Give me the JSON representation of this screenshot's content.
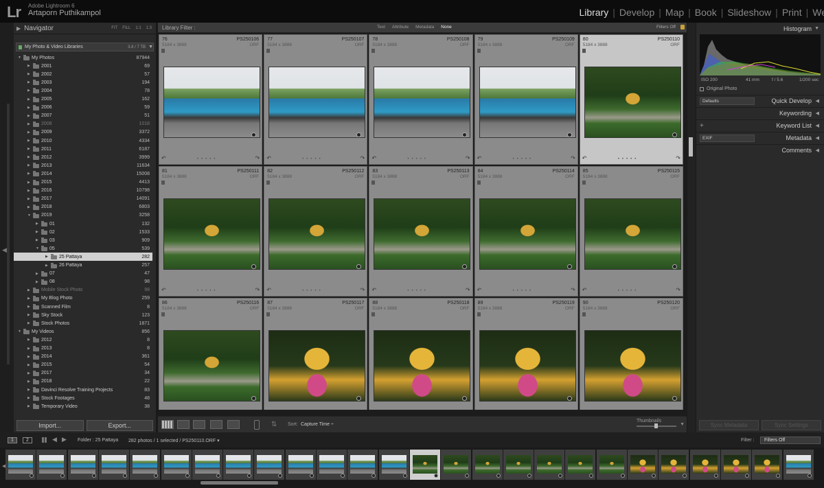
{
  "app": {
    "logo": "Lr",
    "name": "Adobe Lightroom 6",
    "user": "Artaporn Puthikampol"
  },
  "modules": [
    "Library",
    "Develop",
    "Map",
    "Book",
    "Slideshow",
    "Print",
    "We"
  ],
  "active_module": "Library",
  "left_panel": {
    "navigator": {
      "title": "Navigator",
      "zoom_options": [
        "FIT",
        "FILL",
        "1:1",
        "1:3"
      ]
    },
    "library": {
      "name": "My Photo & Video  Libraries",
      "size": "3.8 / 7 TB"
    },
    "folders": [
      {
        "name": "My Photos",
        "count": "87944",
        "level": 0,
        "expanded": true
      },
      {
        "name": "2001",
        "count": "69",
        "level": 1
      },
      {
        "name": "2002",
        "count": "57",
        "level": 1
      },
      {
        "name": "2003",
        "count": "194",
        "level": 1
      },
      {
        "name": "2004",
        "count": "78",
        "level": 1
      },
      {
        "name": "2005",
        "count": "162",
        "level": 1
      },
      {
        "name": "2006",
        "count": "59",
        "level": 1
      },
      {
        "name": "2007",
        "count": "51",
        "level": 1
      },
      {
        "name": "2008",
        "count": "1018",
        "level": 1,
        "dim": true
      },
      {
        "name": "2009",
        "count": "3372",
        "level": 1
      },
      {
        "name": "2010",
        "count": "4334",
        "level": 1
      },
      {
        "name": "2011",
        "count": "6187",
        "level": 1
      },
      {
        "name": "2012",
        "count": "3999",
        "level": 1
      },
      {
        "name": "2013",
        "count": "11634",
        "level": 1
      },
      {
        "name": "2014",
        "count": "15008",
        "level": 1
      },
      {
        "name": "2015",
        "count": "4413",
        "level": 1
      },
      {
        "name": "2016",
        "count": "10798",
        "level": 1
      },
      {
        "name": "2017",
        "count": "14091",
        "level": 1
      },
      {
        "name": "2018",
        "count": "6803",
        "level": 1
      },
      {
        "name": "2019",
        "count": "3258",
        "level": 1,
        "expanded": true
      },
      {
        "name": "01",
        "count": "132",
        "level": 2
      },
      {
        "name": "02",
        "count": "1533",
        "level": 2
      },
      {
        "name": "03",
        "count": "909",
        "level": 2
      },
      {
        "name": "05",
        "count": "539",
        "level": 2,
        "expanded": true
      },
      {
        "name": "25 Pattaya",
        "count": "282",
        "level": 3,
        "selected": true
      },
      {
        "name": "26 Pattaya",
        "count": "257",
        "level": 3
      },
      {
        "name": "07",
        "count": "47",
        "level": 2
      },
      {
        "name": "08",
        "count": "98",
        "level": 2
      },
      {
        "name": "Mobile Stock Photo",
        "count": "98",
        "level": 1,
        "dim": true
      },
      {
        "name": "My Blog Photo",
        "count": "259",
        "level": 1
      },
      {
        "name": "Scanned Film",
        "count": "8",
        "level": 1
      },
      {
        "name": "Sky Stock",
        "count": "123",
        "level": 1
      },
      {
        "name": "Stock Photos",
        "count": "1871",
        "level": 1
      },
      {
        "name": "My Videos",
        "count": "856",
        "level": 0,
        "expanded": true
      },
      {
        "name": "2012",
        "count": "8",
        "level": 1
      },
      {
        "name": "2013",
        "count": "8",
        "level": 1
      },
      {
        "name": "2014",
        "count": "361",
        "level": 1
      },
      {
        "name": "2015",
        "count": "54",
        "level": 1
      },
      {
        "name": "2017",
        "count": "34",
        "level": 1
      },
      {
        "name": "2018",
        "count": "22",
        "level": 1
      },
      {
        "name": "Davinci Resolve Training Projects",
        "count": "83",
        "level": 1
      },
      {
        "name": "Stock Footages",
        "count": "48",
        "level": 1
      },
      {
        "name": "Temporary Video",
        "count": "38",
        "level": 1
      }
    ],
    "import_label": "Import...",
    "export_label": "Export..."
  },
  "filter_bar": {
    "label": "Library Filter :",
    "options": [
      "Text",
      "Attribute",
      "Metadata",
      "None"
    ],
    "active": "None",
    "status": "Filters Off"
  },
  "grid": [
    {
      "index": "76",
      "file": "PS250106",
      "dims": "5184 x 3888",
      "ext": "ORF",
      "image": "bus"
    },
    {
      "index": "77",
      "file": "PS250107",
      "dims": "5184 x 3888",
      "ext": "ORF",
      "image": "bus"
    },
    {
      "index": "78",
      "file": "PS250108",
      "dims": "5184 x 3888",
      "ext": "ORF",
      "image": "bus"
    },
    {
      "index": "79",
      "file": "PS250109",
      "dims": "5184 x 3888",
      "ext": "ORF",
      "image": "bus"
    },
    {
      "index": "80",
      "file": "PS250110",
      "dims": "5184 x 3888",
      "ext": "ORF",
      "image": "garden",
      "selected": true
    },
    {
      "index": "81",
      "file": "PS250111",
      "dims": "5184 x 3888",
      "ext": "ORF",
      "image": "garden"
    },
    {
      "index": "82",
      "file": "PS250112",
      "dims": "5184 x 3888",
      "ext": "ORF",
      "image": "garden"
    },
    {
      "index": "83",
      "file": "PS250113",
      "dims": "5184 x 3888",
      "ext": "ORF",
      "image": "garden"
    },
    {
      "index": "84",
      "file": "PS250114",
      "dims": "5184 x 3888",
      "ext": "ORF",
      "image": "garden"
    },
    {
      "index": "85",
      "file": "PS250115",
      "dims": "5184 x 3888",
      "ext": "ORF",
      "image": "garden"
    },
    {
      "index": "86",
      "file": "PS250116",
      "dims": "5184 x 3888",
      "ext": "ORF",
      "image": "garden"
    },
    {
      "index": "87",
      "file": "PS250117",
      "dims": "5184 x 3888",
      "ext": "ORF",
      "image": "shrine"
    },
    {
      "index": "88",
      "file": "PS250118",
      "dims": "5184 x 3888",
      "ext": "ORF",
      "image": "shrine"
    },
    {
      "index": "89",
      "file": "PS250119",
      "dims": "5184 x 3888",
      "ext": "ORF",
      "image": "shrine"
    },
    {
      "index": "90",
      "file": "PS250120",
      "dims": "5184 x 3888",
      "ext": "ORF",
      "image": "shrine"
    }
  ],
  "toolbar": {
    "sort_label": "Sort:",
    "sort_value": "Capture Time ÷",
    "thumbnails_label": "Thumbnails",
    "thumbnail_size": 0.48
  },
  "right_panel": {
    "histogram_title": "Histogram",
    "exif": {
      "iso": "ISO 200",
      "focal": "41 mm",
      "aperture": "f / 5.6",
      "shutter": "1/200 sec"
    },
    "original_photo": "Original Photo",
    "quick_develop": {
      "title": "Quick Develop",
      "preset": "Defaults"
    },
    "keywording": "Keywording",
    "keyword_list": "Keyword List",
    "metadata": {
      "title": "Metadata",
      "preset": "EXIF"
    },
    "comments": "Comments",
    "sync_metadata": "Sync Metadata",
    "sync_settings": "Sync Settings"
  },
  "filmstrip_header": {
    "view_1": "1",
    "view_2": "2",
    "folder": "Folder : 25 Pattaya",
    "count": "282 photos / 1 selected / PS250110.ORF ▾",
    "filter_label": "Filter :",
    "filter_value": "Filters Off"
  },
  "filmstrip": [
    "bus",
    "bus",
    "bus",
    "bus",
    "bus",
    "bus",
    "bus",
    "bus",
    "bus",
    "bus",
    "bus",
    "bus",
    "bus",
    "garden",
    "garden",
    "garden",
    "garden",
    "garden",
    "garden",
    "garden",
    "shrine",
    "shrine",
    "shrine",
    "shrine",
    "shrine",
    "bus"
  ],
  "filmstrip_selected": 13
}
